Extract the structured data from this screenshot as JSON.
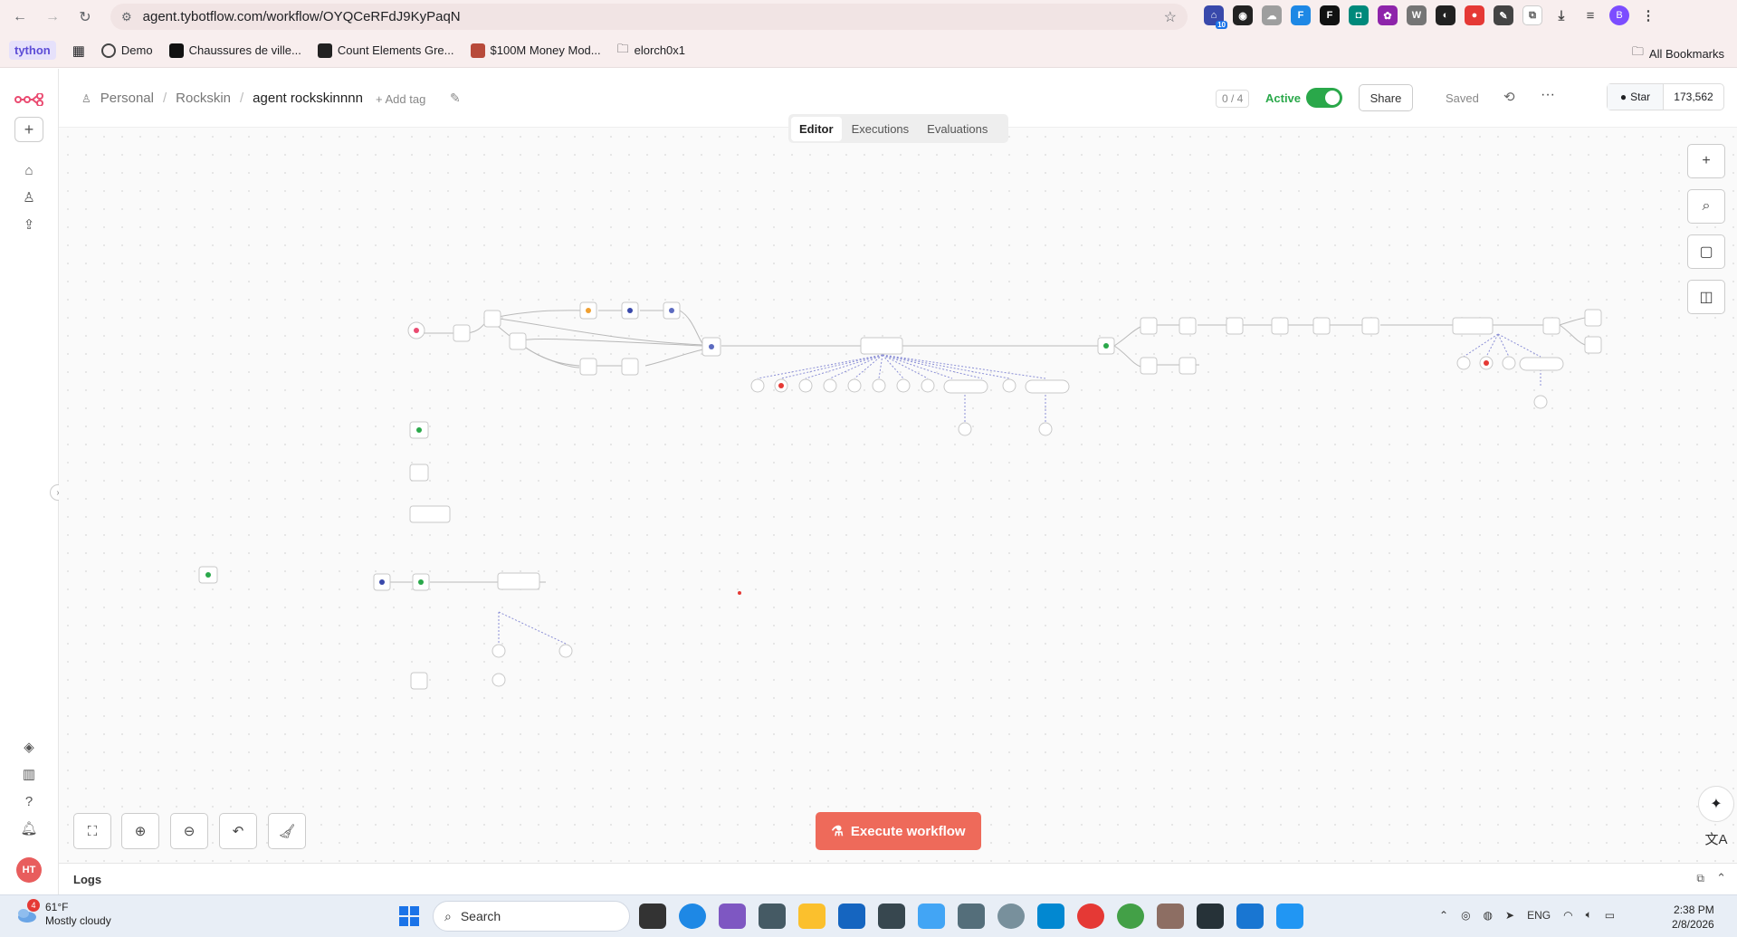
{
  "browser": {
    "url": "agent.tybotflow.com/workflow/OYQCeRFdJ9KyPaqN",
    "bookmarks": [
      "tython",
      "Demo",
      "Chaussures de ville...",
      "Count Elements Gre...",
      "$100M Money Mod...",
      "elorch0x1"
    ],
    "all_bookmarks": "All Bookmarks",
    "ext_badge": "10",
    "profile_initial": "B"
  },
  "header": {
    "crumbs": [
      "Personal",
      "Rockskin",
      "agent rockskinnnn"
    ],
    "add_tag": "+ Add tag",
    "counter": "0 / 4",
    "active_label": "Active",
    "share": "Share",
    "saved": "Saved",
    "star": "Star",
    "star_count": "173,562"
  },
  "tabs": [
    "Editor",
    "Executions",
    "Evaluations"
  ],
  "sidebar": {
    "avatar": "HT"
  },
  "canvas": {
    "execute": "Execute workflow"
  },
  "logs": {
    "label": "Logs"
  },
  "taskbar": {
    "temp": "61°F",
    "weather": "Mostly cloudy",
    "weather_badge": "4",
    "search": "Search",
    "lang": "ENG",
    "time": "2:38 PM",
    "date": "2/8/2026"
  },
  "colors": {
    "accent": "#ee6a5a",
    "active": "#2aa84a"
  }
}
